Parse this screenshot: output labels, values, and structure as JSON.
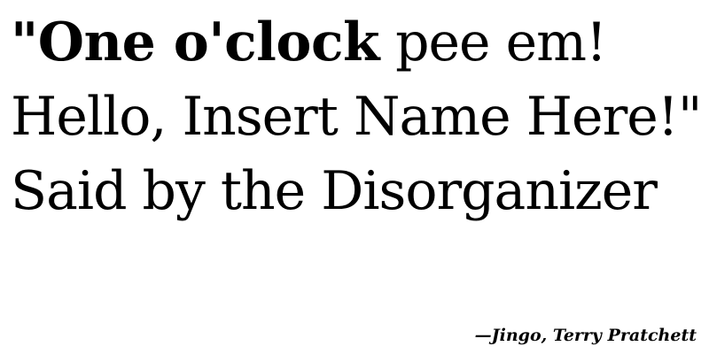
{
  "quote": {
    "line1_bold": "\"One o'clock",
    "line1_rest": " pee em!",
    "line2": "Hello, Insert Name Here!\"",
    "line3": "Said by the Disorganizer"
  },
  "attribution": "—Jingo, Terry Pratchett"
}
